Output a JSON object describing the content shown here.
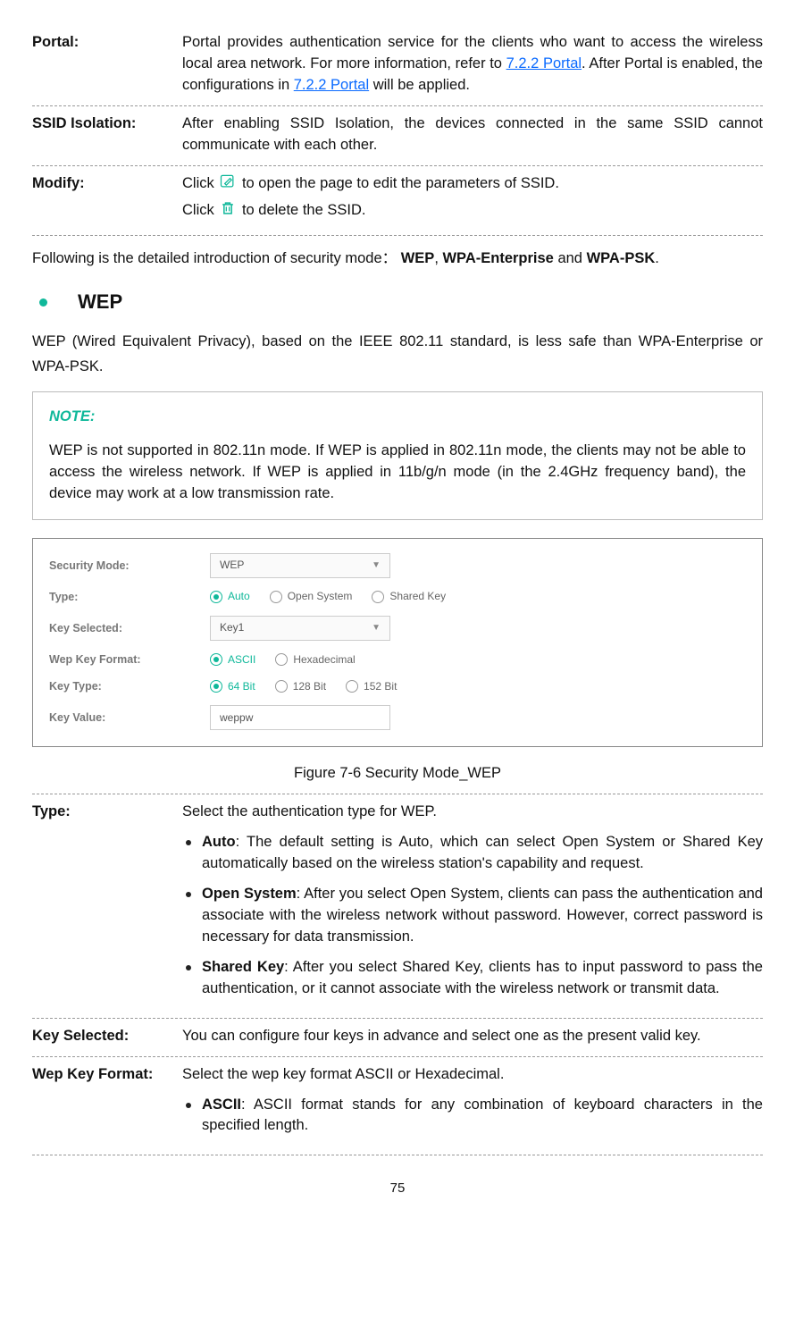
{
  "rows_top": {
    "portal": {
      "label": "Portal:",
      "text_a": "Portal provides authentication service for the clients who want to access the wireless local area network. For more information, refer to ",
      "link1": "7.2.2 Portal",
      "text_b": ". After Portal is enabled, the configurations in ",
      "link2": "7.2.2 Portal",
      "text_c": " will be applied."
    },
    "ssid_iso": {
      "label": "SSID Isolation:",
      "text": "After enabling SSID Isolation, the devices connected in the same SSID cannot communicate with each other."
    },
    "modify": {
      "label": "Modify:",
      "line1_a": "Click ",
      "line1_b": " to open the page to edit the parameters of SSID.",
      "line2_a": "Click ",
      "line2_b": " to delete the SSID."
    }
  },
  "intro": {
    "a": "Following is the detailed introduction of security mode： ",
    "b1": "WEP",
    "c": ", ",
    "b2": "WPA-Enterprise",
    "d": " and ",
    "b3": "WPA-PSK",
    "e": "."
  },
  "bullet_heading": "WEP",
  "wep_para": "WEP (Wired Equivalent Privacy), based on the IEEE 802.11 standard, is less safe than WPA-Enterprise or WPA-PSK.",
  "note": {
    "label": "NOTE:",
    "text": "WEP is not supported in 802.11n mode. If WEP is applied in 802.11n mode, the clients may not be able to access the wireless network. If WEP is applied in 11b/g/n mode (in the 2.4GHz frequency band), the device may work at a low transmission rate."
  },
  "fig": {
    "security_mode": {
      "label": "Security Mode:",
      "value": "WEP"
    },
    "type": {
      "label": "Type:",
      "opts": [
        "Auto",
        "Open System",
        "Shared Key"
      ],
      "selected": 0
    },
    "key_selected": {
      "label": "Key Selected:",
      "value": "Key1"
    },
    "wep_key_format": {
      "label": "Wep Key Format:",
      "opts": [
        "ASCII",
        "Hexadecimal"
      ],
      "selected": 0
    },
    "key_type": {
      "label": "Key Type:",
      "opts": [
        "64 Bit",
        "128 Bit",
        "152 Bit"
      ],
      "selected": 0
    },
    "key_value": {
      "label": "Key Value:",
      "value": "weppw"
    }
  },
  "fig_caption": "Figure 7-6 Security Mode_WEP",
  "rows_bottom": {
    "type": {
      "label": "Type:",
      "intro": "Select the authentication type for WEP.",
      "items": [
        {
          "b": "Auto",
          "t": ": The default setting is Auto, which can select Open System or Shared Key automatically based on the wireless station's capability and request."
        },
        {
          "b": "Open System",
          "t": ": After you select Open System, clients can pass the authentication and associate with the wireless network without password. However, correct password is necessary for data transmission."
        },
        {
          "b": "Shared Key",
          "t": ": After you select Shared Key, clients has to input password to pass the authentication, or it cannot associate with the wireless network or transmit data."
        }
      ]
    },
    "key_selected": {
      "label": "Key Selected:",
      "text": "You can configure four keys in advance and select one as the present valid key."
    },
    "wep_key_format": {
      "label": "Wep Key Format:",
      "intro": "Select the wep key format ASCII or Hexadecimal.",
      "items": [
        {
          "b": "ASCII",
          "t": ": ASCII format stands for any combination of keyboard characters in the specified length."
        }
      ]
    }
  },
  "page_number": "75"
}
